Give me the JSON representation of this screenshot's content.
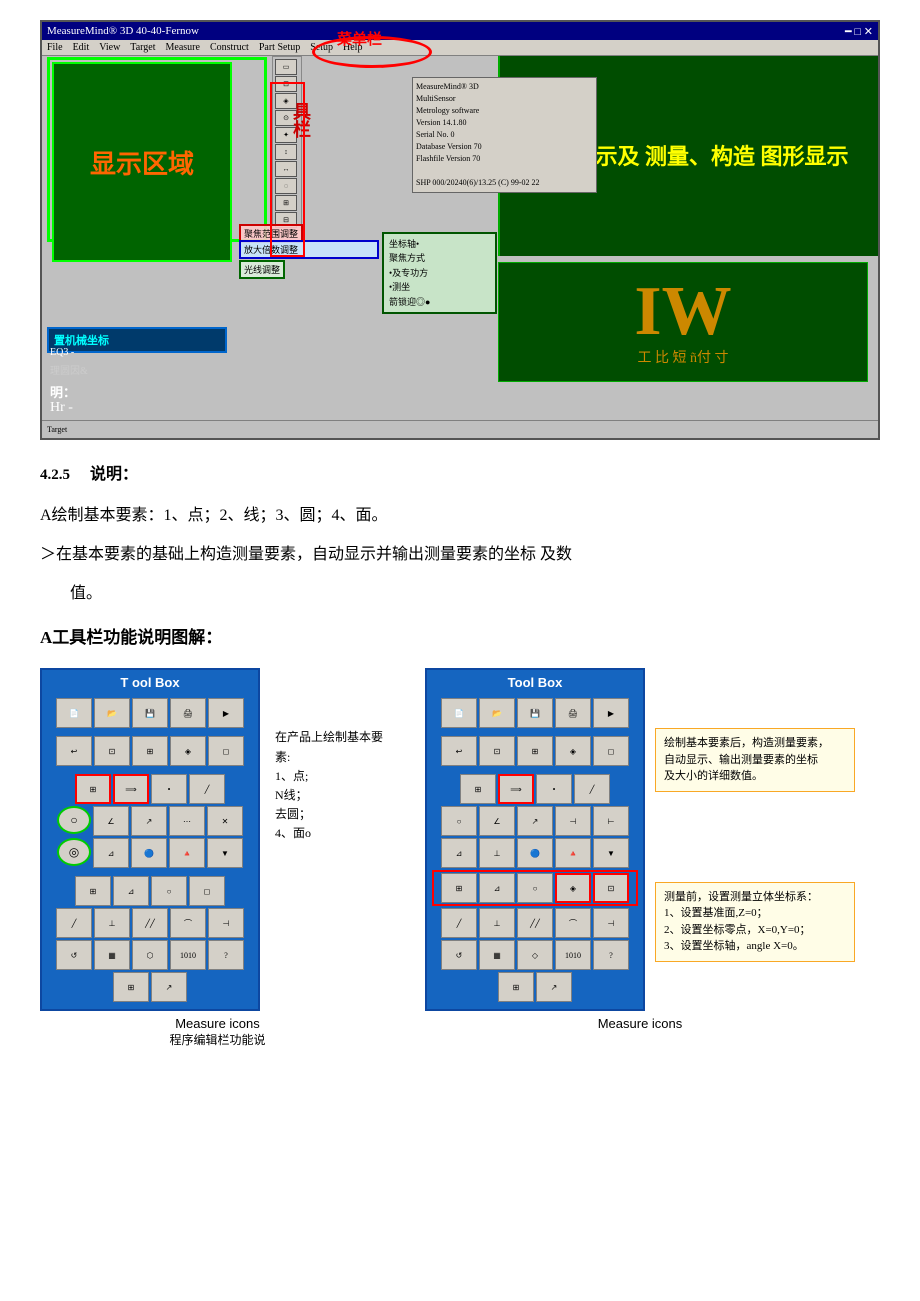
{
  "section": {
    "number": "4.2.5",
    "title": "说明："
  },
  "screenshot": {
    "titlebar": "MeasureMind® 3D 40-40-Fernow",
    "menuItems": [
      "File",
      "Edit",
      "View",
      "Target",
      "Measure",
      "Construct",
      "Part Setup",
      "Setup",
      "Help"
    ],
    "infoBoxTitle": "MeasureMind® 3D\nMultiSensor",
    "displayAreaText": "显示区域",
    "toolbarLabel": "工具栏",
    "topAnnotation": "菜单栏",
    "rangeLabel": "聚焦范围调整",
    "zoomLabel": "放大倍数调整",
    "lightLabel": "光线调整",
    "coordLabel": "坐标轴•聚焦方式•及专功方•测坐•箭锁迎◎●",
    "machCoordLabel": "置机械坐标",
    "eq3": "EQ3 -",
    "rational": "理圆因&",
    "hm": "明：",
    "hr": "Hr -",
    "iwText": "IW",
    "iwSubtext": "工 比 短 ñ付 寸",
    "rightHeader": "绘图显示及\n测量、构造\n图形显示",
    "jbText": "具栏"
  },
  "paragraphs": {
    "p1": "A绘制基本要素：1、点；2、线；3、圆；4、面。",
    "p2": "＞在基本要素的基础上构造测量要素，自动显示并输出测量要素的坐标 及数",
    "p3": "值。",
    "heading": "A工具栏功能说明图解："
  },
  "toolbox_left": {
    "title": "T ool Box",
    "annotation_text": "在产品上绘制基本要素:\n1、点;\nN线；\n去圆；\n4、面o"
  },
  "toolbox_right": {
    "title": "Tool Box",
    "callout1": {
      "text": "绘制基本要素后，构造测量要素，\n自动显示、输出测量要素的坐标\n及大小的详细数值。"
    },
    "callout2": {
      "text": "测量前，设置测量立体坐标系：\n1、设置基准面,Z=0；\n2、设置坐标零点，X=0,Y=0；\n3、设置坐标轴，angle X=0。"
    }
  },
  "labels": {
    "measure_icons_left": "Measure icons",
    "measure_icons_right": "Measure icons",
    "prog_edit": "程序编辑栏功能说"
  }
}
